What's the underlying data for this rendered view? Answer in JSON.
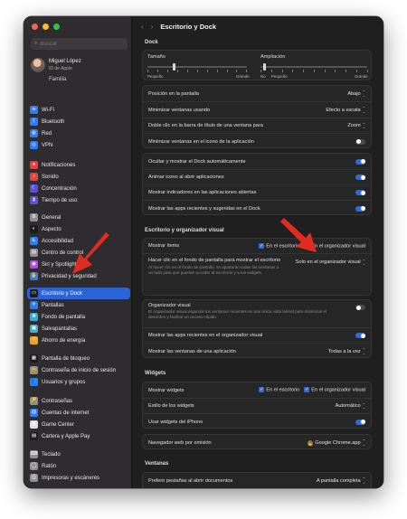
{
  "window_title": "Escritorio y Dock",
  "search": {
    "placeholder": "Buscar"
  },
  "user": {
    "name": "Miguel López",
    "subtitle": "ID de Apple",
    "family": "Familia"
  },
  "sidebar_groups": [
    [
      {
        "label": "Wi-Fi",
        "icon": "wifi-icon",
        "color": "#2d7cf6",
        "glyph": "≋"
      },
      {
        "label": "Bluetooth",
        "icon": "bluetooth-icon",
        "color": "#2d7cf6",
        "glyph": "ᛒ"
      },
      {
        "label": "Red",
        "icon": "network-icon",
        "color": "#2d7cf6",
        "glyph": "◍"
      },
      {
        "label": "VPN",
        "icon": "vpn-icon",
        "color": "#2d7cf6",
        "glyph": "◎"
      }
    ],
    [
      {
        "label": "Notificaciones",
        "icon": "notifications-icon",
        "color": "#e5413b",
        "glyph": "●"
      },
      {
        "label": "Sonido",
        "icon": "sound-icon",
        "color": "#e5413b",
        "glyph": "♪"
      },
      {
        "label": "Concentración",
        "icon": "focus-icon",
        "color": "#5b4fd6",
        "glyph": "☾"
      },
      {
        "label": "Tiempo de uso",
        "icon": "screen-time-icon",
        "color": "#5b4fd6",
        "glyph": "⧗"
      }
    ],
    [
      {
        "label": "General",
        "icon": "general-icon",
        "color": "#8e8e93",
        "glyph": "⚙"
      },
      {
        "label": "Aspecto",
        "icon": "appearance-icon",
        "color": "#1c1c1e",
        "glyph": "◐"
      },
      {
        "label": "Accesibilidad",
        "icon": "accessibility-icon",
        "color": "#2d7cf6",
        "glyph": "♿"
      },
      {
        "label": "Centro de control",
        "icon": "control-center-icon",
        "color": "#8e8e93",
        "glyph": "▤"
      },
      {
        "label": "Siri y Spotlight",
        "icon": "siri-icon",
        "color": "#b04fd6",
        "glyph": "◉"
      },
      {
        "label": "Privacidad y seguridad",
        "icon": "privacy-icon",
        "color": "#2d7cf6",
        "glyph": "✋"
      }
    ],
    [
      {
        "label": "Escritorio y Dock",
        "icon": "desktop-dock-icon",
        "color": "#1c1c1e",
        "glyph": "▭",
        "selected": true
      },
      {
        "label": "Pantallas",
        "icon": "displays-icon",
        "color": "#2d7cf6",
        "glyph": "☀"
      },
      {
        "label": "Fondo de pantalla",
        "icon": "wallpaper-icon",
        "color": "#36a9e1",
        "glyph": "❋"
      },
      {
        "label": "Salvapantallas",
        "icon": "screensaver-icon",
        "color": "#36b3c9",
        "glyph": "▣"
      },
      {
        "label": "Ahorro de energía",
        "icon": "energy-icon",
        "color": "#f0a31e",
        "glyph": "⚡"
      }
    ],
    [
      {
        "label": "Pantalla de bloqueo",
        "icon": "lock-screen-icon",
        "color": "#1c1c1e",
        "glyph": "▦"
      },
      {
        "label": "Contraseña de inicio de sesión",
        "icon": "login-password-icon",
        "color": "#8e8e93",
        "glyph": "🔒"
      },
      {
        "label": "Usuarios y grupos",
        "icon": "users-groups-icon",
        "color": "#2d7cf6",
        "glyph": "👥"
      }
    ],
    [
      {
        "label": "Contraseñas",
        "icon": "passwords-icon",
        "color": "#8e8e93",
        "glyph": "🔑"
      },
      {
        "label": "Cuentas de internet",
        "icon": "internet-accounts-icon",
        "color": "#2d7cf6",
        "glyph": "@"
      },
      {
        "label": "Game Center",
        "icon": "game-center-icon",
        "color": "#e0e0e0",
        "glyph": "◍"
      },
      {
        "label": "Cartera y Apple Pay",
        "icon": "wallet-icon",
        "color": "#1c1c1e",
        "glyph": "▤"
      }
    ],
    [
      {
        "label": "Teclado",
        "icon": "keyboard-icon",
        "color": "#8e8e93",
        "glyph": "⌨"
      },
      {
        "label": "Ratón",
        "icon": "mouse-icon",
        "color": "#8e8e93",
        "glyph": "◯"
      },
      {
        "label": "Impresoras y escáneres",
        "icon": "printers-icon",
        "color": "#8e8e93",
        "glyph": "⎙"
      }
    ]
  ],
  "dock": {
    "section": "Dock",
    "size_label": "Tamaño",
    "size_min": "Pequeño",
    "size_max": "Grande",
    "size_value": 0.27,
    "mag_label": "Ampliación",
    "mag_no": "No",
    "mag_min": "Pequeño",
    "mag_max": "Grande",
    "mag_value": 0.04,
    "position_label": "Posición en la pantalla",
    "position_value": "Abajo",
    "minimize_label": "Minimizar ventanas usando",
    "minimize_value": "Efecto a escala",
    "doubleclick_label": "Doble clic en la barra de título de una ventana para",
    "doubleclick_value": "Zoom",
    "minimize_icon_label": "Minimizar ventanas en el icono de la aplicación",
    "minimize_icon_on": false,
    "autohide_label": "Ocultar y mostrar el Dock automáticamente",
    "autohide_on": true,
    "animate_label": "Animar icono al abrir aplicaciones",
    "animate_on": true,
    "indicators_label": "Mostrar indicadores en las aplicaciones abiertas",
    "indicators_on": true,
    "recent_label": "Mostrar las apps recientes y sugeridas en el Dock",
    "recent_on": true
  },
  "stage": {
    "section": "Escritorio y organizador visual",
    "show_items_label": "Mostrar ítems",
    "show_desktop": "En el escritorio",
    "show_stage": "En el organizador visual",
    "click_wallpaper_label": "Hacer clic en el fondo de pantalla para mostrar el escritorio",
    "click_wallpaper_desc": "Al hacer clic en el fondo de pantalla, se apartarán todas las ventanas a un lado para que puedas acceder al escritorio y a tus widgets.",
    "click_wallpaper_value": "Solo en el organizador visual",
    "stage_label": "Organizador visual",
    "stage_desc": "El organizador visual organiza tus ventanas recientes en una única vista lateral para minimizar el desorden y facilitar un acceso rápido.",
    "stage_on": false,
    "stage_recent_label": "Mostrar las apps recientes en el organizador visual",
    "stage_recent_on": true,
    "stage_windows_label": "Mostrar las ventanas de una aplicación",
    "stage_windows_value": "Todas a la vez"
  },
  "widgets": {
    "section": "Widgets",
    "show_label": "Mostrar widgets",
    "show_desktop": "En el escritorio",
    "show_stage": "En el organizador visual",
    "style_label": "Estilo de los widgets",
    "style_value": "Automático",
    "iphone_label": "Usar widgets del iPhone",
    "iphone_on": true
  },
  "browser": {
    "label": "Navegador web por omisión",
    "value": "Google Chrome.app"
  },
  "windows": {
    "section": "Ventanas",
    "tabs_label": "Preferir pestañas al abrir documentos",
    "tabs_value": "A pantalla completa"
  }
}
